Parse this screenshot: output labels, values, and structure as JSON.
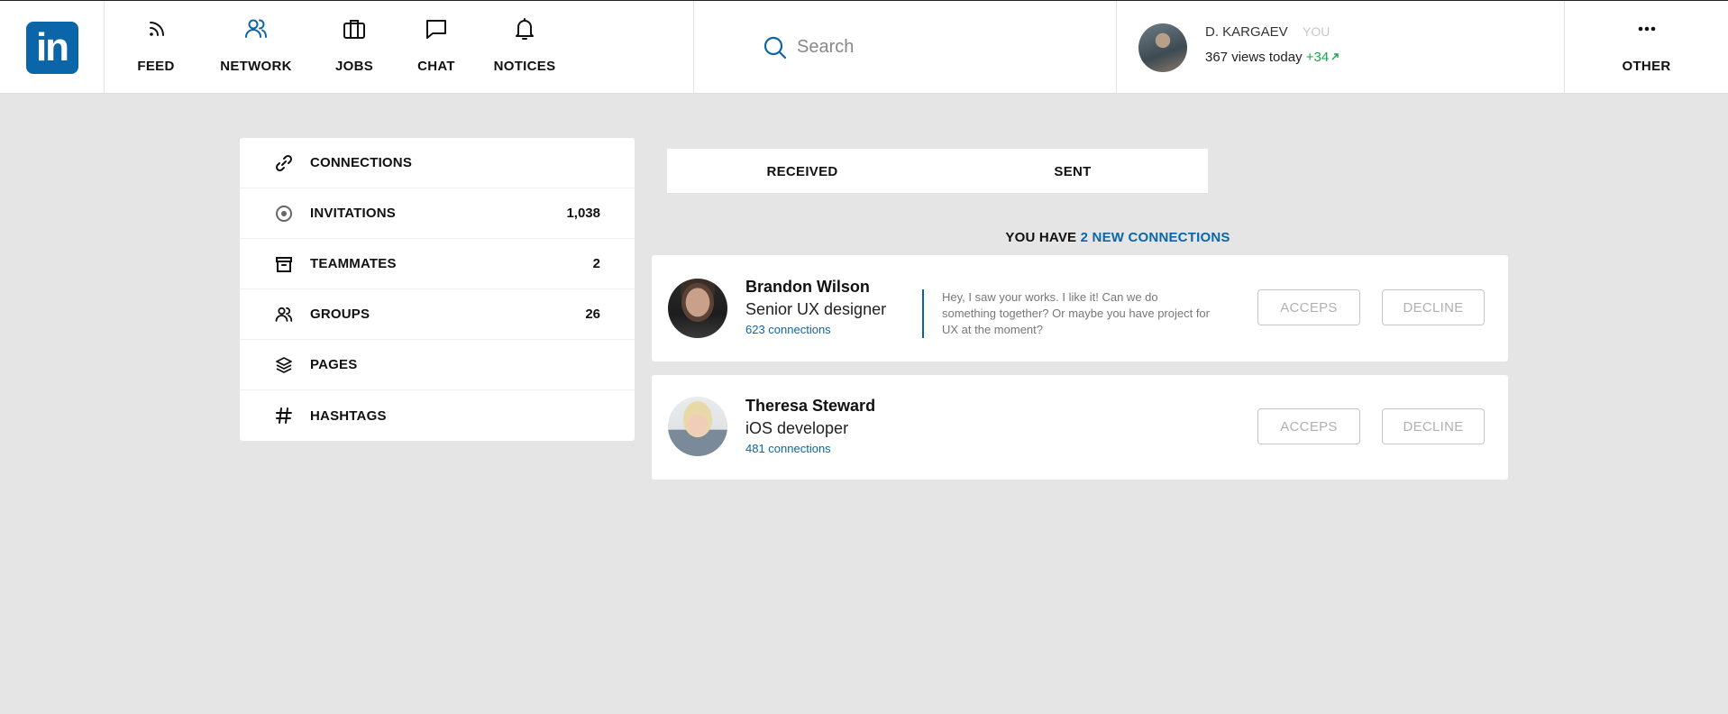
{
  "header": {
    "logo_text": "in",
    "nav": [
      {
        "label": "FEED",
        "icon": "rss-icon"
      },
      {
        "label": "NETWORK",
        "icon": "users-icon",
        "active": true
      },
      {
        "label": "JOBS",
        "icon": "briefcase-icon"
      },
      {
        "label": "CHAT",
        "icon": "chat-bubble-icon"
      },
      {
        "label": "NOTICES",
        "icon": "bell-icon"
      }
    ],
    "search": {
      "placeholder": "Search",
      "value": ""
    },
    "profile": {
      "name": "D. KARGAEV",
      "you_label": "YOU",
      "views": "367 views today",
      "views_delta": "+34"
    },
    "other_label": "OTHER"
  },
  "sidebar": {
    "items": [
      {
        "label": "CONNECTIONS",
        "count": "",
        "icon": "link-icon"
      },
      {
        "label": "INVITATIONS",
        "count": "1,038",
        "icon": "target-icon"
      },
      {
        "label": "TEAMMATES",
        "count": "2",
        "icon": "archive-icon"
      },
      {
        "label": "GROUPS",
        "count": "26",
        "icon": "users-icon"
      },
      {
        "label": "PAGES",
        "count": "",
        "icon": "layers-icon"
      },
      {
        "label": "HASHTAGS",
        "count": "",
        "icon": "hashtag-icon"
      }
    ]
  },
  "tabs": [
    {
      "label": "RECEIVED"
    },
    {
      "label": "SENT"
    }
  ],
  "summary": {
    "prefix": "YOU HAVE",
    "highlight": "2 NEW CONNECTIONS"
  },
  "requests": [
    {
      "name": "Brandon Wilson",
      "role": "Senior UX designer",
      "connections": "623 connections",
      "message": "Hey, I saw your works. I like it! Can we do something together? Or maybe you have project for UX at the moment?",
      "accept_label": "ACCEPS",
      "decline_label": "DECLINE"
    },
    {
      "name": "Theresa Steward",
      "role": "iOS developer",
      "connections": "481 connections",
      "message": "",
      "accept_label": "ACCEPS",
      "decline_label": "DECLINE"
    }
  ],
  "colors": {
    "brand": "#0a66a8",
    "background": "#e5e5e5",
    "positive": "#1aa34a"
  }
}
